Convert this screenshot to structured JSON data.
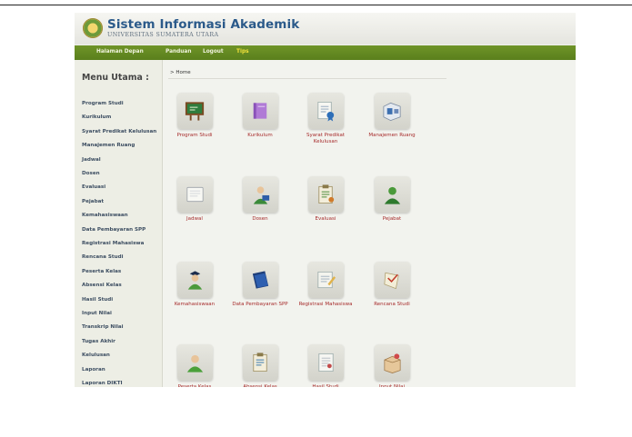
{
  "header": {
    "title": "Sistem Informasi Akademik",
    "subtitle": "UNIVERSITAS SUMATERA UTARA",
    "logo_icon": "university-seal-icon"
  },
  "topnav": {
    "items": [
      {
        "label": "Halaman Depan",
        "active": false
      },
      {
        "label": "Panduan",
        "active": false
      },
      {
        "label": "Logout",
        "active": false
      },
      {
        "label": "Tips",
        "active": true
      }
    ]
  },
  "sidebar": {
    "title": "Menu Utama :",
    "items": [
      "Program Studi",
      "Kurikulum",
      "Syarat Predikat Kelulusan",
      "Manajemen Ruang",
      "Jadwal",
      "Dosen",
      "Evaluasi",
      "Pejabat",
      "Kemahasiswaan",
      "Data Pembayaran SPP",
      "Registrasi Mahasiswa",
      "Rencana Studi",
      "Peserta Kelas",
      "Absensi Kelas",
      "Hasil Studi",
      "Input Nilai",
      "Transkrip Nilai",
      "Tugas Akhir",
      "Kelulusan",
      "Laporan",
      "Laporan DIKTI"
    ]
  },
  "main": {
    "breadcrumb": "> Home",
    "tiles": [
      {
        "label": "Program Studi",
        "icon": "chalkboard-icon"
      },
      {
        "label": "Kurikulum",
        "icon": "book-icon"
      },
      {
        "label": "Syarat Predikat Kelulusan",
        "icon": "certificate-icon"
      },
      {
        "label": "Manajemen Ruang",
        "icon": "room-icon"
      },
      {
        "label": "Jadwal",
        "icon": "notebook-icon"
      },
      {
        "label": "Dosen",
        "icon": "lecturer-icon"
      },
      {
        "label": "Evaluasi",
        "icon": "clipboard-icon"
      },
      {
        "label": "Pejabat",
        "icon": "official-icon"
      },
      {
        "label": "Kemahasiswaan",
        "icon": "student-icon"
      },
      {
        "label": "Data Pembayaran SPP",
        "icon": "ledger-icon"
      },
      {
        "label": "Registrasi Mahasiswa",
        "icon": "register-form-icon"
      },
      {
        "label": "Rencana Studi",
        "icon": "study-plan-icon"
      },
      {
        "label": "Peserta Kelas",
        "icon": "class-participant-icon"
      },
      {
        "label": "Absensi Kelas",
        "icon": "attendance-icon"
      },
      {
        "label": "Hasil Studi",
        "icon": "study-result-icon"
      },
      {
        "label": "Input Nilai",
        "icon": "grade-box-icon"
      }
    ]
  }
}
